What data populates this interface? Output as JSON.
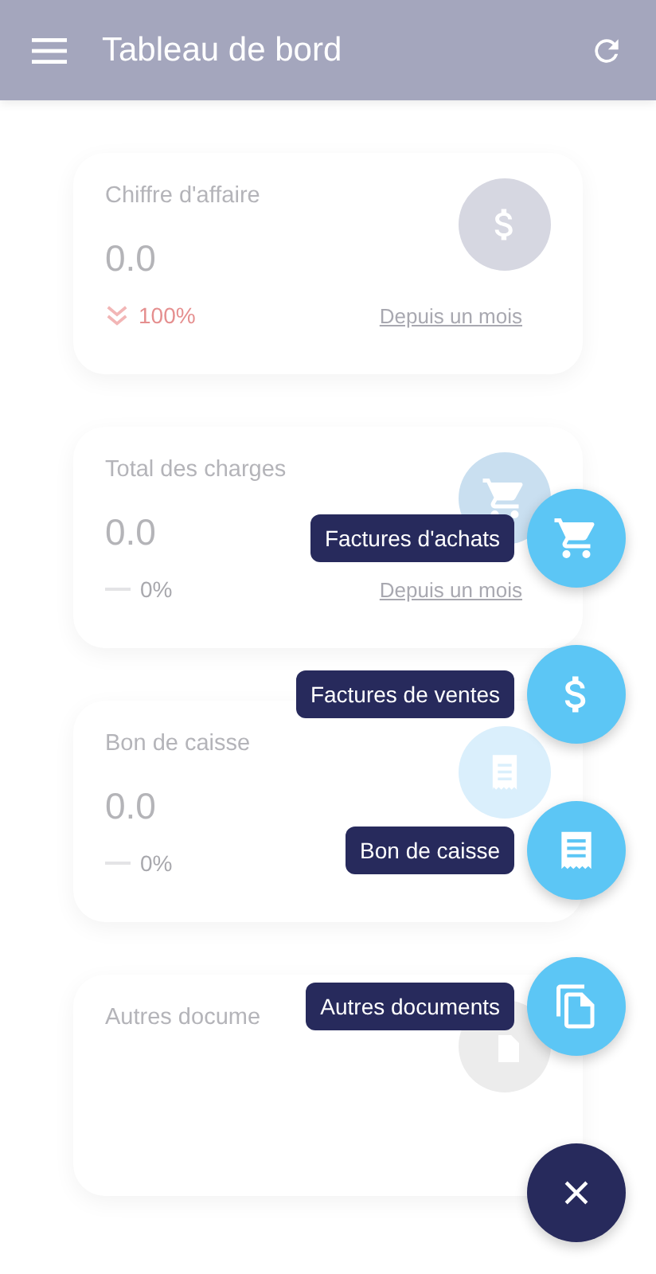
{
  "app_bar": {
    "title": "Tableau de bord"
  },
  "cards": [
    {
      "title": "Chiffre d'affaire",
      "value": "0.0",
      "color": "#d6d7e1",
      "trend": {
        "kind": "down",
        "text": "100%"
      },
      "period": "Depuis un mois"
    },
    {
      "title": "Total des charges",
      "value": "0.0",
      "color": "#c9dff0",
      "trend": {
        "kind": "flat",
        "text": "0%"
      },
      "period": "Depuis un mois"
    },
    {
      "title": "Bon de caisse",
      "value": "0.0",
      "color": "#daeffc",
      "trend": {
        "kind": "flat",
        "text": "0%"
      }
    },
    {
      "title": "Autres docume",
      "color": "#ececec"
    }
  ],
  "fab_menu": {
    "open": true,
    "items": [
      {
        "label": "Factures d'achats"
      },
      {
        "label": "Factures de ventes"
      },
      {
        "label": "Bon de caisse"
      },
      {
        "label": "Autres documents"
      }
    ]
  }
}
